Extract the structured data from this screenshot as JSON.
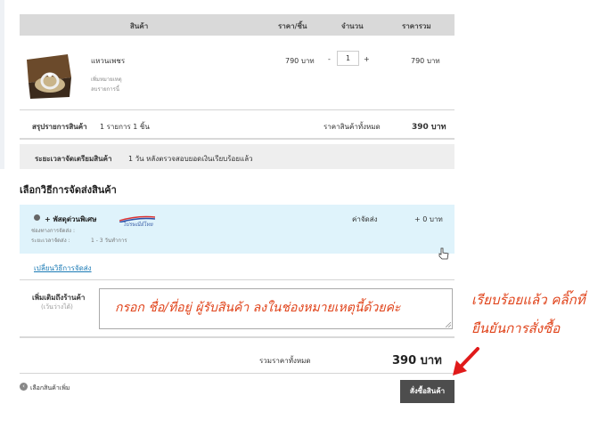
{
  "table": {
    "col_product": "สินค้า",
    "col_price": "ราคา/ชิ้น",
    "col_qty": "จำนวน",
    "col_total": "ราคารวม"
  },
  "item": {
    "name": "แหวนเพชร",
    "note_link": "เพิ่มหมายเหตุ",
    "remove_link": "ลบรายการนี้",
    "price": "790 บาท",
    "qty_minus": "-",
    "qty": "1",
    "qty_plus": "+",
    "total": "790 บาท"
  },
  "summary": {
    "label": "สรุปรายการสินค้า",
    "count": "1 รายการ 1 ชิ้น",
    "all_label": "ราคาสินค้าทั้งหมด",
    "all_value": "390 บาท"
  },
  "prep": {
    "label": "ระยะเวลาจัดเตรียมสินค้า",
    "text": "1 วัน หลังตรวจสอบยอดเงินเรียบร้อยแล้ว"
  },
  "shipping": {
    "heading": "เลือกวิธีการจัดส่งสินค้า",
    "option_name": "+ พัสดุด่วนพิเศษ",
    "channel": "ช่องทางการจัดส่ง :",
    "duration_label": "ระยะเวลาจัดส่ง :",
    "duration": "1 - 3 วันทำการ",
    "fee_label": "ค่าจัดส่ง",
    "fee_value": "+ 0 บาท",
    "change_link": "เปลี่ยนวิธีการจัดส่ง",
    "logo_text": "ไปรษณีย์ไทย"
  },
  "note": {
    "label": "เพิ่มเติมถึงร้านค้า",
    "sub": "(เว้นว่างได้)",
    "handwritten": "กรอก ชื่อ/ที่อยู่ ผู้รับสินค้า ลงในช่องหมายเหตุนี้ด้วยค่ะ"
  },
  "total": {
    "label": "รวมราคาทั้งหมด",
    "value": "390 บาท"
  },
  "actions": {
    "continue_shopping": "เลือกสินค้าเพิ่ม",
    "order_button": "สั่งซื้อสินค้า"
  },
  "annotation": {
    "line1": "เรียบร้อยแล้ว คลิ๊กที่",
    "line2": "ยืนยันการสั่งซื้อ"
  },
  "colors": {
    "annotation": "#e0431a",
    "header_bg": "#d9d9d9",
    "shipping_bg": "#dff3fb",
    "button_bg": "#4d4d4d"
  }
}
